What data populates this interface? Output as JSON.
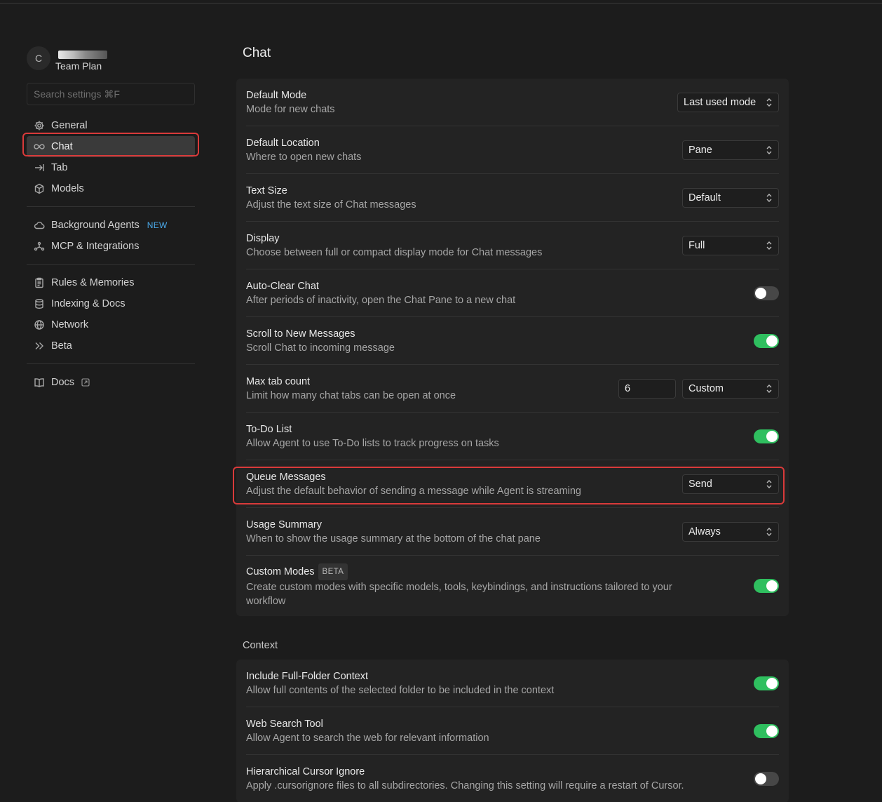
{
  "profile": {
    "avatar_initial": "C",
    "plan": "Team Plan"
  },
  "search": {
    "placeholder": "Search settings ⌘F"
  },
  "sidebar": {
    "group1": [
      {
        "label": "General",
        "icon": "gear-icon"
      },
      {
        "label": "Chat",
        "icon": "infinity-icon",
        "active": true
      },
      {
        "label": "Tab",
        "icon": "tab-arrow-icon"
      },
      {
        "label": "Models",
        "icon": "cube-icon"
      }
    ],
    "group2": [
      {
        "label": "Background Agents",
        "icon": "cloud-icon",
        "badge": "NEW"
      },
      {
        "label": "MCP & Integrations",
        "icon": "network-nodes-icon"
      }
    ],
    "group3": [
      {
        "label": "Rules & Memories",
        "icon": "clipboard-icon"
      },
      {
        "label": "Indexing & Docs",
        "icon": "database-icon"
      },
      {
        "label": "Network",
        "icon": "globe-icon"
      },
      {
        "label": "Beta",
        "icon": "double-chevron-icon"
      }
    ],
    "group4": [
      {
        "label": "Docs",
        "icon": "book-icon"
      }
    ]
  },
  "main": {
    "title": "Chat",
    "chat_settings": [
      {
        "title": "Default Mode",
        "desc": "Mode for new chats",
        "control": "select",
        "value": "Last used mode"
      },
      {
        "title": "Default Location",
        "desc": "Where to open new chats",
        "control": "select",
        "value": "Pane"
      },
      {
        "title": "Text Size",
        "desc": "Adjust the text size of Chat messages",
        "control": "select",
        "value": "Default"
      },
      {
        "title": "Display",
        "desc": "Choose between full or compact display mode for Chat messages",
        "control": "select",
        "value": "Full"
      },
      {
        "title": "Auto-Clear Chat",
        "desc": "After periods of inactivity, open the Chat Pane to a new chat",
        "control": "toggle",
        "value": "off"
      },
      {
        "title": "Scroll to New Messages",
        "desc": "Scroll Chat to incoming message",
        "control": "toggle",
        "value": "on"
      },
      {
        "title": "Max tab count",
        "desc": "Limit how many chat tabs can be open at once",
        "control": "number-select",
        "number": "6",
        "value": "Custom"
      },
      {
        "title": "To-Do List",
        "desc": "Allow Agent to use To-Do lists to track progress on tasks",
        "control": "toggle",
        "value": "on"
      },
      {
        "title": "Queue Messages",
        "desc": "Adjust the default behavior of sending a message while Agent is streaming",
        "control": "select",
        "value": "Send"
      },
      {
        "title": "Usage Summary",
        "desc": "When to show the usage summary at the bottom of the chat pane",
        "control": "select",
        "value": "Always"
      },
      {
        "title": "Custom Modes",
        "badge": "BETA",
        "desc": "Create custom modes with specific models, tools, keybindings, and instructions tailored to your workflow",
        "control": "toggle",
        "value": "on"
      }
    ],
    "context_title": "Context",
    "context_settings": [
      {
        "title": "Include Full-Folder Context",
        "desc": "Allow full contents of the selected folder to be included in the context",
        "control": "toggle",
        "value": "on"
      },
      {
        "title": "Web Search Tool",
        "desc": "Allow Agent to search the web for relevant information",
        "control": "toggle",
        "value": "on"
      },
      {
        "title": "Hierarchical Cursor Ignore",
        "desc": "Apply .cursorignore files to all subdirectories. Changing this setting will require a restart of Cursor.",
        "control": "toggle",
        "value": "off"
      }
    ]
  },
  "colors": {
    "toggle_on": "#2fbf5f",
    "highlight": "#d93a3a",
    "new_badge": "#4aa8e8"
  }
}
